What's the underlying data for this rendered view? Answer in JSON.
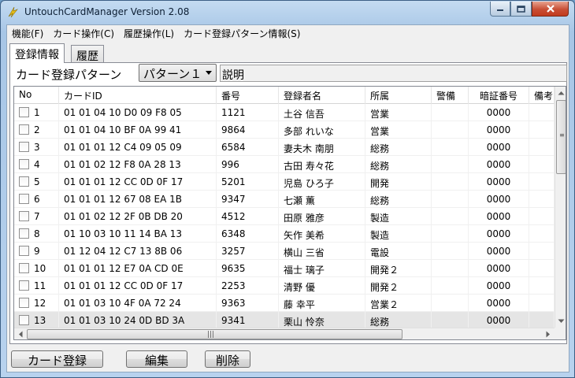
{
  "window": {
    "title": "UntouchCardManager  Version 2.08"
  },
  "menu": [
    {
      "label": "機能(F)"
    },
    {
      "label": "カード操作(C)"
    },
    {
      "label": "履歴操作(L)"
    },
    {
      "label": "カード登録パターン情報(S)"
    }
  ],
  "tabs": {
    "registration": "登録情報",
    "history": "履歴"
  },
  "pattern": {
    "label": "カード登録パターン",
    "selected": "パターン１",
    "description": "説明"
  },
  "table": {
    "columns": [
      "No",
      "カードID",
      "番号",
      "登録者名",
      "所属",
      "警備",
      "暗証番号",
      "備考"
    ],
    "rows": [
      {
        "no": "1",
        "card_id": "01 01 04 10 D0 09 F8 05",
        "number": "1121",
        "name": "土谷 信吾",
        "dept": "営業",
        "security": "",
        "pin": "0000"
      },
      {
        "no": "2",
        "card_id": "01 01 04 10 BF 0A 99 41",
        "number": "9864",
        "name": "多部 れいな",
        "dept": "営業",
        "security": "",
        "pin": "0000"
      },
      {
        "no": "3",
        "card_id": "01 01 01 12 C4 09 05 09",
        "number": "6584",
        "name": "妻夫木 南朋",
        "dept": "総務",
        "security": "",
        "pin": "0000"
      },
      {
        "no": "4",
        "card_id": "01 01 02 12 F8 0A 28 13",
        "number": "996",
        "name": "古田 寿々花",
        "dept": "総務",
        "security": "",
        "pin": "0000"
      },
      {
        "no": "5",
        "card_id": "01 01 01 12 CC 0D 0F 17",
        "number": "5201",
        "name": "児島 ひろ子",
        "dept": "開発",
        "security": "",
        "pin": "0000"
      },
      {
        "no": "6",
        "card_id": "01 01 01 12 67 08 EA 1B",
        "number": "9347",
        "name": "七瀬 薫",
        "dept": "総務",
        "security": "",
        "pin": "0000"
      },
      {
        "no": "7",
        "card_id": "01 01 02 12 2F 0B DB 20",
        "number": "4512",
        "name": "田原 雅彦",
        "dept": "製造",
        "security": "",
        "pin": "0000"
      },
      {
        "no": "8",
        "card_id": "01 10 03 10 11 14 BA 13",
        "number": "6348",
        "name": "矢作 美希",
        "dept": "製造",
        "security": "",
        "pin": "0000"
      },
      {
        "no": "9",
        "card_id": "01 12 04 12 C7 13 8B 06",
        "number": "3257",
        "name": "横山 三省",
        "dept": "電設",
        "security": "",
        "pin": "0000"
      },
      {
        "no": "10",
        "card_id": "01 01 01 12 E7 0A CD 0E",
        "number": "9635",
        "name": "福士 璃子",
        "dept": "開発２",
        "security": "",
        "pin": "0000"
      },
      {
        "no": "11",
        "card_id": "01 01 01 12 CC 0D 0F 17",
        "number": "2253",
        "name": "清野 優",
        "dept": "開発２",
        "security": "",
        "pin": "0000"
      },
      {
        "no": "12",
        "card_id": "01 01 03 10 4F 0A 72 24",
        "number": "9363",
        "name": "藤 幸平",
        "dept": "営業２",
        "security": "",
        "pin": "0000"
      },
      {
        "no": "13",
        "card_id": "01 01 03 10 24 0D BD 3A",
        "number": "9341",
        "name": "栗山 怜奈",
        "dept": "総務",
        "security": "",
        "pin": "0000"
      }
    ]
  },
  "buttons": {
    "register": "カード登録",
    "edit": "編集",
    "delete": "削除"
  },
  "scrollbar": {
    "grip": "≡",
    "hgrip": "|||"
  },
  "colors": {
    "close_button": "#c84f35",
    "title_gradient_top": "#c4dbf1",
    "selected_row": "#e5e5e5"
  }
}
